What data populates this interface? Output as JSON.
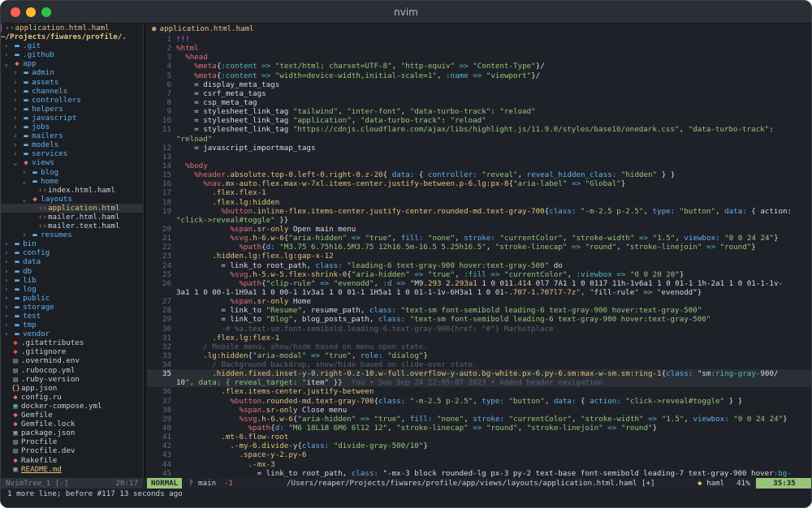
{
  "window": {
    "title": "nvim"
  },
  "colors": {
    "background": "#1e2228",
    "sidebar": "#1b1f24",
    "mode_accent": "#98c379",
    "directory": "#61afef",
    "keyword_tag": "#e06c75",
    "string": "#98c379",
    "symbol": "#56b6c2",
    "class": "#e5c07b",
    "comment": "#5c6370"
  },
  "sidebar": {
    "header_file": "application.html.haml",
    "cwd": "~/Projects/fiwares/profile/.",
    "items": [
      {
        "kind": "dir",
        "depth": 0,
        "arrow": "›",
        "icon": "folder-icon",
        "name": ".git"
      },
      {
        "kind": "dir",
        "depth": 0,
        "arrow": "›",
        "icon": "folder-icon",
        "name": ".github"
      },
      {
        "kind": "open",
        "depth": 0,
        "arrow": "⌄",
        "icon": "ruby-icon",
        "name": "app"
      },
      {
        "kind": "dir",
        "depth": 1,
        "arrow": "›",
        "icon": "folder-icon",
        "name": "admin"
      },
      {
        "kind": "dir",
        "depth": 1,
        "arrow": "›",
        "icon": "folder-icon",
        "name": "assets"
      },
      {
        "kind": "dir",
        "depth": 1,
        "arrow": "›",
        "icon": "folder-icon",
        "name": "channels"
      },
      {
        "kind": "dir",
        "depth": 1,
        "arrow": "›",
        "icon": "folder-icon",
        "name": "controllers"
      },
      {
        "kind": "dir",
        "depth": 1,
        "arrow": "›",
        "icon": "folder-icon",
        "name": "helpers"
      },
      {
        "kind": "dir",
        "depth": 1,
        "arrow": "›",
        "icon": "folder-icon",
        "name": "javascript"
      },
      {
        "kind": "dir",
        "depth": 1,
        "arrow": "›",
        "icon": "folder-icon",
        "name": "jobs"
      },
      {
        "kind": "dir",
        "depth": 1,
        "arrow": "›",
        "icon": "folder-icon",
        "name": "mailers"
      },
      {
        "kind": "dir",
        "depth": 1,
        "arrow": "›",
        "icon": "folder-icon",
        "name": "models"
      },
      {
        "kind": "dir",
        "depth": 1,
        "arrow": "›",
        "icon": "folder-icon",
        "name": "services"
      },
      {
        "kind": "open",
        "depth": 1,
        "arrow": "⌄",
        "icon": "ruby-icon",
        "name": "views"
      },
      {
        "kind": "dir",
        "depth": 2,
        "arrow": "›",
        "icon": "folder-icon",
        "name": "blog"
      },
      {
        "kind": "open",
        "depth": 2,
        "arrow": "⌄",
        "icon": "folder-icon",
        "name": "home"
      },
      {
        "kind": "file",
        "depth": 3,
        "arrow": "",
        "icon": "html-icon",
        "name": "index.html.haml"
      },
      {
        "kind": "open",
        "depth": 2,
        "arrow": "⌄",
        "icon": "ruby-icon",
        "name": "layouts"
      },
      {
        "kind": "active",
        "depth": 3,
        "arrow": "",
        "icon": "html-icon",
        "name": "application.html"
      },
      {
        "kind": "file",
        "depth": 3,
        "arrow": "",
        "icon": "html-icon",
        "name": "mailer.html.haml"
      },
      {
        "kind": "file",
        "depth": 3,
        "arrow": "",
        "icon": "html-icon",
        "name": "mailer.text.haml"
      },
      {
        "kind": "dir",
        "depth": 2,
        "arrow": "›",
        "icon": "folder-icon",
        "name": "resumes"
      },
      {
        "kind": "dir",
        "depth": 0,
        "arrow": "›",
        "icon": "folder-icon",
        "name": "bin"
      },
      {
        "kind": "dir",
        "depth": 0,
        "arrow": "›",
        "icon": "folder-icon",
        "name": "config"
      },
      {
        "kind": "dir",
        "depth": 0,
        "arrow": "›",
        "icon": "folder-icon",
        "name": "data"
      },
      {
        "kind": "dir",
        "depth": 0,
        "arrow": "›",
        "icon": "folder-icon",
        "name": "db"
      },
      {
        "kind": "dir",
        "depth": 0,
        "arrow": "›",
        "icon": "folder-icon",
        "name": "lib"
      },
      {
        "kind": "dir",
        "depth": 0,
        "arrow": "›",
        "icon": "folder-icon",
        "name": "log"
      },
      {
        "kind": "dir",
        "depth": 0,
        "arrow": "›",
        "icon": "folder-icon",
        "name": "public"
      },
      {
        "kind": "dir",
        "depth": 0,
        "arrow": "›",
        "icon": "folder-icon",
        "name": "storage"
      },
      {
        "kind": "dir",
        "depth": 0,
        "arrow": "›",
        "icon": "folder-icon",
        "name": "test"
      },
      {
        "kind": "dir",
        "depth": 0,
        "arrow": "›",
        "icon": "folder-icon",
        "name": "tmp"
      },
      {
        "kind": "dir",
        "depth": 0,
        "arrow": "›",
        "icon": "folder-icon",
        "name": "vendor"
      },
      {
        "kind": "file",
        "depth": 0,
        "arrow": "",
        "icon": "git-icon",
        "name": ".gitattributes"
      },
      {
        "kind": "file",
        "depth": 0,
        "arrow": "",
        "icon": "git-icon",
        "name": ".gitignore"
      },
      {
        "kind": "file",
        "depth": 0,
        "arrow": "",
        "icon": "file-icon",
        "name": ".overmind.env"
      },
      {
        "kind": "file",
        "depth": 0,
        "arrow": "",
        "icon": "file-icon",
        "name": ".rubocop.yml"
      },
      {
        "kind": "file",
        "depth": 0,
        "arrow": "",
        "icon": "file-icon",
        "name": ".ruby-version"
      },
      {
        "kind": "file",
        "depth": 0,
        "arrow": "",
        "icon": "json-icon",
        "name": "app.json"
      },
      {
        "kind": "file",
        "depth": 0,
        "arrow": "",
        "icon": "ruby-icon",
        "name": "config.ru"
      },
      {
        "kind": "file",
        "depth": 0,
        "arrow": "",
        "icon": "docker-icon",
        "name": "docker-compose.yml"
      },
      {
        "kind": "file",
        "depth": 0,
        "arrow": "",
        "icon": "ruby-icon",
        "name": "Gemfile"
      },
      {
        "kind": "file",
        "depth": 0,
        "arrow": "",
        "icon": "ruby-icon",
        "name": "Gemfile.lock"
      },
      {
        "kind": "file",
        "depth": 0,
        "arrow": "",
        "icon": "lock-icon",
        "name": "package.json"
      },
      {
        "kind": "file",
        "depth": 0,
        "arrow": "",
        "icon": "file-icon",
        "name": "Procfile"
      },
      {
        "kind": "file",
        "depth": 0,
        "arrow": "",
        "icon": "file-icon",
        "name": "Procfile.dev"
      },
      {
        "kind": "file",
        "depth": 0,
        "arrow": "",
        "icon": "ruby-icon",
        "name": "Rakefile"
      },
      {
        "kind": "readme",
        "depth": 0,
        "arrow": "",
        "icon": "markdown-icon",
        "name": "README.md"
      }
    ]
  },
  "editor": {
    "tab": "application.html.haml",
    "virtual_text": "You • Sun Sep 24 22:05:07 2023 • Added header navigation",
    "cursor_line": 35,
    "lines": [
      {
        "n": "1",
        "t": "!!!"
      },
      {
        "n": "2",
        "t": "%html"
      },
      {
        "n": "3",
        "t": "  %head"
      },
      {
        "n": "4",
        "t": "    %meta{:content => \"text/html; charset=UTF-8\", \"http-equiv\" => \"Content-Type\"}/"
      },
      {
        "n": "5",
        "t": "    %meta{:content => \"width=device-width,initial-scale=1\", :name => \"viewport\"}/"
      },
      {
        "n": "6",
        "t": "    = display_meta_tags"
      },
      {
        "n": "7",
        "t": "    = csrf_meta_tags"
      },
      {
        "n": "8",
        "t": "    = csp_meta_tag"
      },
      {
        "n": "9",
        "t": "    = stylesheet_link_tag \"tailwind\", \"inter-font\", \"data-turbo-track\": \"reload\""
      },
      {
        "n": "10",
        "t": "    = stylesheet_link_tag \"application\", \"data-turbo-track\": \"reload\""
      },
      {
        "n": "11",
        "t": "    = stylesheet_link_tag \"https://cdnjs.cloudflare.com/ajax/libs/highlight.js/11.9.0/styles/base16/onedark.css\", \"data-turbo-track\":"
      },
      {
        "n": "",
        "t": "\"reload\""
      },
      {
        "n": "12",
        "t": "    = javascript_importmap_tags"
      },
      {
        "n": "13",
        "t": ""
      },
      {
        "n": "14",
        "t": "  %body"
      },
      {
        "n": "15",
        "t": "    %header.absolute.top-0.left-0.right-0.z-20{ data: { controller: \"reveal\", reveal_hidden_class: \"hidden\" } }"
      },
      {
        "n": "16",
        "t": "      %nav.mx-auto.flex.max-w-7xl.items-center.justify-between.p-6.lg:px-8{\"aria-label\" => \"Global\"}"
      },
      {
        "n": "17",
        "t": "        .flex.flex-1"
      },
      {
        "n": "18",
        "t": "        .flex.lg:hidden"
      },
      {
        "n": "19",
        "t": "          %button.inline-flex.items-center.justify-center.rounded-md.text-gray-700{class: \"-m-2.5 p-2.5\", type: \"button\", data: { action:"
      },
      {
        "n": "",
        "t": "\"click->reveal#toggle\" }}"
      },
      {
        "n": "20",
        "t": "            %span.sr-only Open main menu"
      },
      {
        "n": "21",
        "t": "            %svg.h-6.w-6{\"aria-hidden\" => \"true\", fill: \"none\", stroke: \"currentColor\", \"stroke-width\" => \"1.5\", viewbox: \"0 0 24 24\"}"
      },
      {
        "n": "22",
        "t": "              %path{d: \"M3.75 6.75h16.5M3.75 12h16.5m-16.5 5.25h16.5\", \"stroke-linecap\" => \"round\", \"stroke-linejoin\" => \"round\"}"
      },
      {
        "n": "23",
        "t": "        .hidden.lg:flex.lg:gap-x-12"
      },
      {
        "n": "24",
        "t": "          = link_to root_path, class: \"leading-6 text-gray-900 hover:text-gray-500\" do"
      },
      {
        "n": "25",
        "t": "            %svg.h-5.w-5.flex-shrink-0{\"aria-hidden\" => \"true\", :fill => \"currentColor\", :viewbox => \"0 0 20 20\"}"
      },
      {
        "n": "26",
        "t": "              %path{\"clip-rule\" => \"evenodd\", :d => \"M9.293 2.293a1 1 0 011.414 0l7 7A1 1 0 0117 11h-1v6a1 1 0 01-1 1h-2a1 1 0 01-1-1v-"
      },
      {
        "n": "",
        "t": "3a1 1 0 00-1-1H9a1 1 0 00-1 1v3a1 1 0 01-1 1H5a1 1 0 01-1-1v-6H3a1 1 0 01-.707-1.707l7-7z\", \"fill-rule\" => \"evenodd\"}"
      },
      {
        "n": "27",
        "t": "            %span.sr-only Home"
      },
      {
        "n": "28",
        "t": "          = link_to \"Resume\", resume_path, class: \"text-sm font-semibold leading-6 text-gray-900 hover:text-gray-500\""
      },
      {
        "n": "29",
        "t": "          = link_to \"Blog\", blog_posts_path, class: \"text-sm font-semibold leading-6 text-gray-900 hover:text-gray-500\""
      },
      {
        "n": "30",
        "t": "          -# %a.text-sm.font-semibold.leading-6.text-gray-900{href: \"#\"} Marketplace"
      },
      {
        "n": "31",
        "t": "        .flex.lg:flex-1"
      },
      {
        "n": "32",
        "t": "      / Mobile menu, show/hide based on menu open state."
      },
      {
        "n": "33",
        "t": "      .lg:hidden{\"aria-modal\" => \"true\", role: \"dialog\"}"
      },
      {
        "n": "34",
        "t": "        / Background backdrop, show/hide based on slide-over state."
      },
      {
        "n": "35",
        "t": "        .hidden.fixed.inset-y-0.right-0.z-10.w-full.overflow-y-auto.bg-white.px-6.py-6.sm:max-w-sm.sm:ring-1{class: \"sm:ring-gray-900/"
      },
      {
        "n": "",
        "t": "10\", data: { reveal_target: \"item\" }}"
      },
      {
        "n": "36",
        "t": "          .flex.items-center.justify-between"
      },
      {
        "n": "37",
        "t": "            %button.rounded-md.text-gray-700{class: \"-m-2.5 p-2.5\", type: \"button\", data: { action: \"click->reveal#toggle\" } }"
      },
      {
        "n": "38",
        "t": "              %span.sr-only Close menu"
      },
      {
        "n": "39",
        "t": "              %svg.h-6.w-6{\"aria-hidden\" => \"true\", fill: \"none\", stroke: \"currentColor\", \"stroke-width\" => \"1.5\", viewbox: \"0 0 24 24\"}"
      },
      {
        "n": "40",
        "t": "                %path{d: \"M6 18L18 6M6 6l12 12\", \"stroke-linecap\" => \"round\", \"stroke-linejoin\" => \"round\"}"
      },
      {
        "n": "41",
        "t": "          .mt-6.flow-root"
      },
      {
        "n": "42",
        "t": "            .-my-6.divide-y{class: \"divide-gray-500/10\"}"
      },
      {
        "n": "43",
        "t": "              .space-y-2.py-6"
      },
      {
        "n": "44",
        "t": "                .-mx-3"
      },
      {
        "n": "45",
        "t": "                  = link_to root_path, class: \"-mx-3 block rounded-lg px-3 py-2 text-base font-semibold leading-7 text-gray-900 hover:bg-"
      }
    ]
  },
  "statusline": {
    "tree_label": "NvimTree_1 [-]",
    "tree_pos": "20:17",
    "mode": "NORMAL",
    "branch": "main",
    "diff": "-1",
    "path": "/Users/reaper/Projects/fiwares/profile/app/views/layouts/application.html.haml [+]",
    "filetype": "haml",
    "percent": "41%",
    "position": "35:35"
  },
  "cmdline": {
    "message": "1 more line; before #117  13 seconds ago"
  }
}
